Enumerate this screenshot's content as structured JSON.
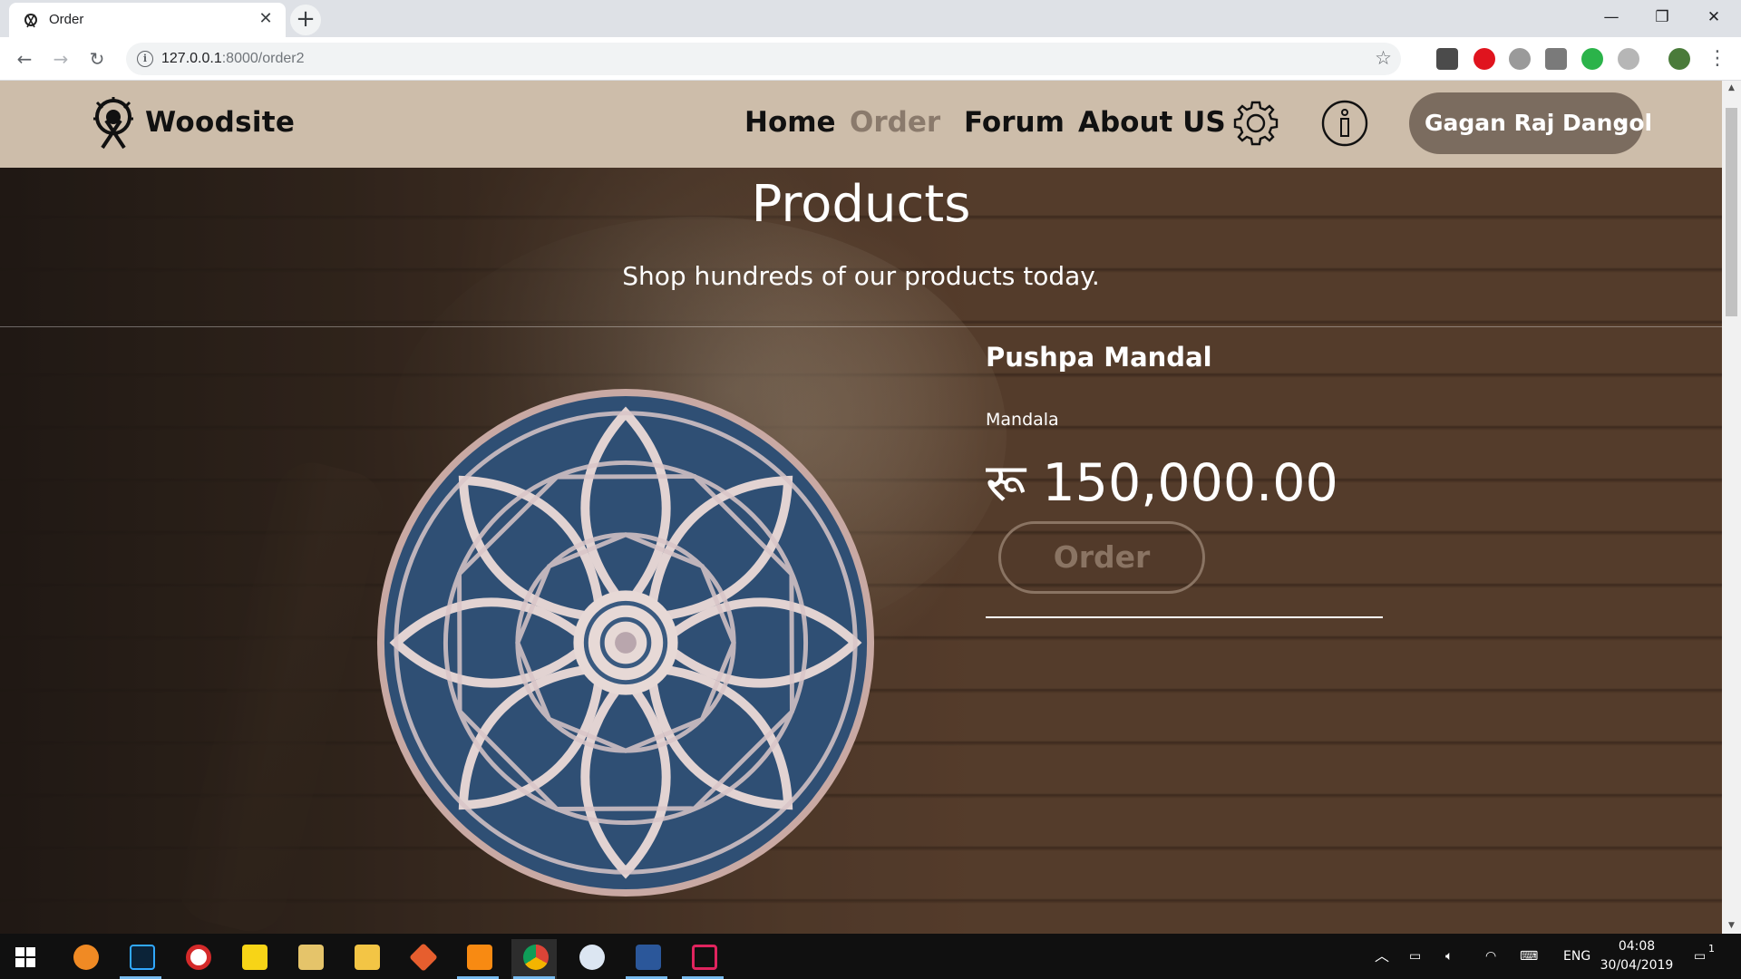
{
  "browser": {
    "tab_title": "Order",
    "url_host": "127.0.0.1",
    "url_rest": ":8000/order2",
    "window_controls": [
      "minimize-icon",
      "restore-icon",
      "close-icon"
    ]
  },
  "navbar": {
    "brand": "Woodsite",
    "links": [
      "Home",
      "Order",
      "Forum",
      "About US"
    ],
    "active_link": "Order",
    "user_name": "Gagan Raj Dangol"
  },
  "hero": {
    "title": "Products",
    "subtitle": "Shop hundreds of our products today."
  },
  "product": {
    "name": "Pushpa Mandal",
    "category": "Mandala",
    "price": "रू 150,000.00",
    "order_label": "Order"
  },
  "taskbar": {
    "apps": [
      "windows-start",
      "edge",
      "photoshop",
      "app-red-swirl",
      "sticky-notes",
      "notepad",
      "file-explorer",
      "git",
      "sublime-text",
      "chrome",
      "paint",
      "word",
      "mobile-connect"
    ],
    "tray": {
      "language": "ENG",
      "time": "04:08",
      "date": "30/04/2019",
      "notification_count": "1"
    }
  },
  "colors": {
    "navbar_bg": "#cdbdaa",
    "active_link": "#8a7a6c",
    "user_button": "#7b6c5f",
    "order_button_border": "#8a7463"
  }
}
